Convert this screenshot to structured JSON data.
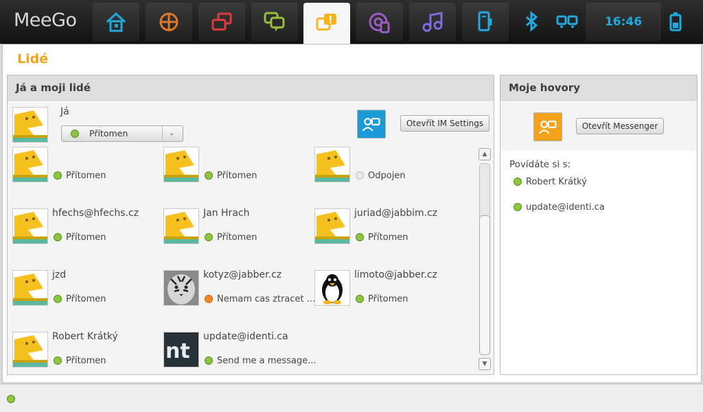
{
  "taskbar": {
    "logo": "MeeGo",
    "clock": "16:46",
    "tabs": [
      {
        "icon": "home-icon"
      },
      {
        "icon": "zones-icon"
      },
      {
        "icon": "applications-icon"
      },
      {
        "icon": "status-icon"
      },
      {
        "icon": "people-icon",
        "active": true
      },
      {
        "icon": "internet-icon"
      },
      {
        "icon": "media-icon"
      },
      {
        "icon": "devices-icon"
      },
      {
        "icon": "bluetooth-icon"
      },
      {
        "icon": "network-icon"
      },
      {
        "icon": "battery-icon"
      }
    ]
  },
  "app": {
    "title": "Lidé"
  },
  "me_panel": {
    "title": "Já a moji lidé",
    "me_name": "Já",
    "presence": "Přítomen",
    "im_settings_button": "Otevřít IM Settings"
  },
  "contacts": [
    {
      "name": "",
      "status": "Přítomen",
      "state": "online",
      "avatar": "dino"
    },
    {
      "name": "",
      "status": "Přítomen",
      "state": "online",
      "avatar": "dino"
    },
    {
      "name": "",
      "status": "Odpojen",
      "state": "offline",
      "avatar": "dino"
    },
    {
      "name": "hfechs@hfechs.cz",
      "status": "Přítomen",
      "state": "online",
      "avatar": "dino"
    },
    {
      "name": "Jan Hrach",
      "status": "Přítomen",
      "state": "online",
      "avatar": "dino"
    },
    {
      "name": "juriad@jabbim.cz",
      "status": "Přítomen",
      "state": "online",
      "avatar": "dino"
    },
    {
      "name": "jzd",
      "status": "Přítomen",
      "state": "online",
      "avatar": "dino"
    },
    {
      "name": "kotyz@jabber.cz",
      "status": "Nemam cas ztracet ...",
      "state": "away",
      "avatar": "tiger"
    },
    {
      "name": "limoto@jabber.cz",
      "status": "Přítomen",
      "state": "online",
      "avatar": "penguin"
    },
    {
      "name": "Robert Krátký",
      "status": "Přítomen",
      "state": "online",
      "avatar": "dino"
    },
    {
      "name": "update@identi.ca",
      "status": "Send me a message...",
      "state": "online",
      "avatar": "nt"
    }
  ],
  "calls_panel": {
    "title": "Moje hovory",
    "messenger_button": "Otevřít Messenger",
    "talking_label": "Povídáte si s:",
    "talking": [
      "Robert Krátký",
      "update@identi.ca"
    ]
  },
  "colors": {
    "accent": "#f3a31b",
    "online": "#8cc63f",
    "away": "#f08a24",
    "clock": "#22a9e0"
  }
}
